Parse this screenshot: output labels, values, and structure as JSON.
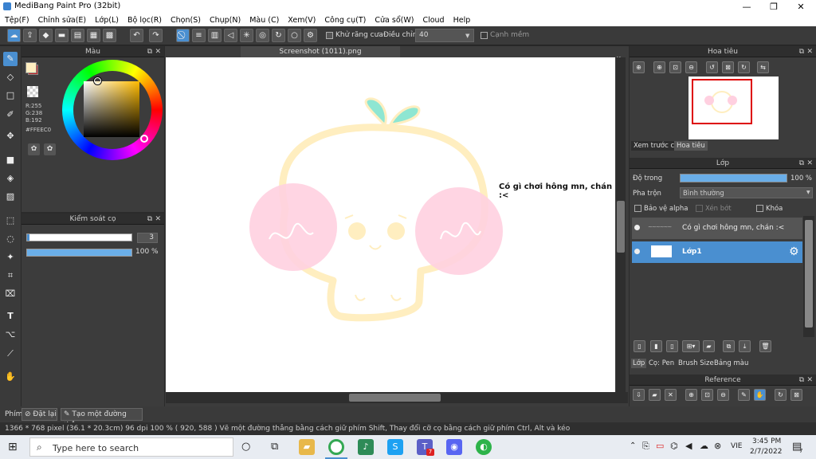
{
  "window": {
    "title": "MediBang Paint Pro (32bit)",
    "controls": [
      "—",
      "❐",
      "✕"
    ]
  },
  "menu": [
    "Tệp(F)",
    "Chỉnh sửa(E)",
    "Lớp(L)",
    "Bộ lọc(R)",
    "Chọn(S)",
    "Chụp(N)",
    "Màu (C)",
    "Xem(V)",
    "Công cụ(T)",
    "Cửa sổ(W)",
    "Cloud",
    "Help"
  ],
  "toolbar": {
    "antialias_label": "Khử răng cưa",
    "adjust_label": "Điều chỉnh",
    "adjust_value": "40",
    "edge_label": "Cạnh mềm"
  },
  "color_panel": {
    "title": "Màu",
    "r": "R:255",
    "g": "G:238",
    "b": "B:192",
    "hex": "#FFEEC0",
    "primary_color": "#FFEEC0",
    "secondary_color": "#cc2222"
  },
  "brush_panel": {
    "title": "Kiểm soát cọ",
    "size": "3",
    "opacity": "100 %",
    "size_fraction": 0.0,
    "opacity_fraction": 1.0
  },
  "canvas": {
    "tab_title": "Screenshot (1011).png",
    "text_layer": "Có gì chơi hông mn, chán :<"
  },
  "navigator": {
    "title": "Hoa tiêu",
    "tabs": [
      "Xem trước cọ",
      "Hoa tiêu"
    ]
  },
  "layers": {
    "title": "Lớp",
    "opacity_label": "Độ trong",
    "opacity_value": "100 %",
    "blend_label": "Pha trộn",
    "blend_value": "Bình thường",
    "protect_alpha": "Bảo vệ alpha",
    "clip": "Xén bớt",
    "lock": "Khóa",
    "items": [
      {
        "name": "Có gì chơi hông mn, chán :<",
        "thumb": "~~~~~~"
      },
      {
        "name": "Lớp1",
        "thumb": ""
      }
    ],
    "bottom_tabs": [
      "Lớp",
      "Cọ: Pen",
      "Brush Size",
      "Bảng màu"
    ]
  },
  "reference": {
    "title": "Reference"
  },
  "bottombar": {
    "tab": "Phím",
    "reset_label": "Đặt lại",
    "line_label": "Tạo một đường thẳng"
  },
  "status": "1366 * 768 pixel  (36.1 * 20.3cm)  96 dpi  100 %  ( 920, 588 )  Vẽ một đường thẳng bằng cách giữ phím Shift, Thay đổi cỡ cọ bằng cách giữ phím Ctrl, Alt và kéo",
  "taskbar": {
    "search_placeholder": "Type here to search",
    "lang": "VIE",
    "time": "3:45 PM",
    "date": "2/7/2022",
    "notif_count": "7"
  }
}
